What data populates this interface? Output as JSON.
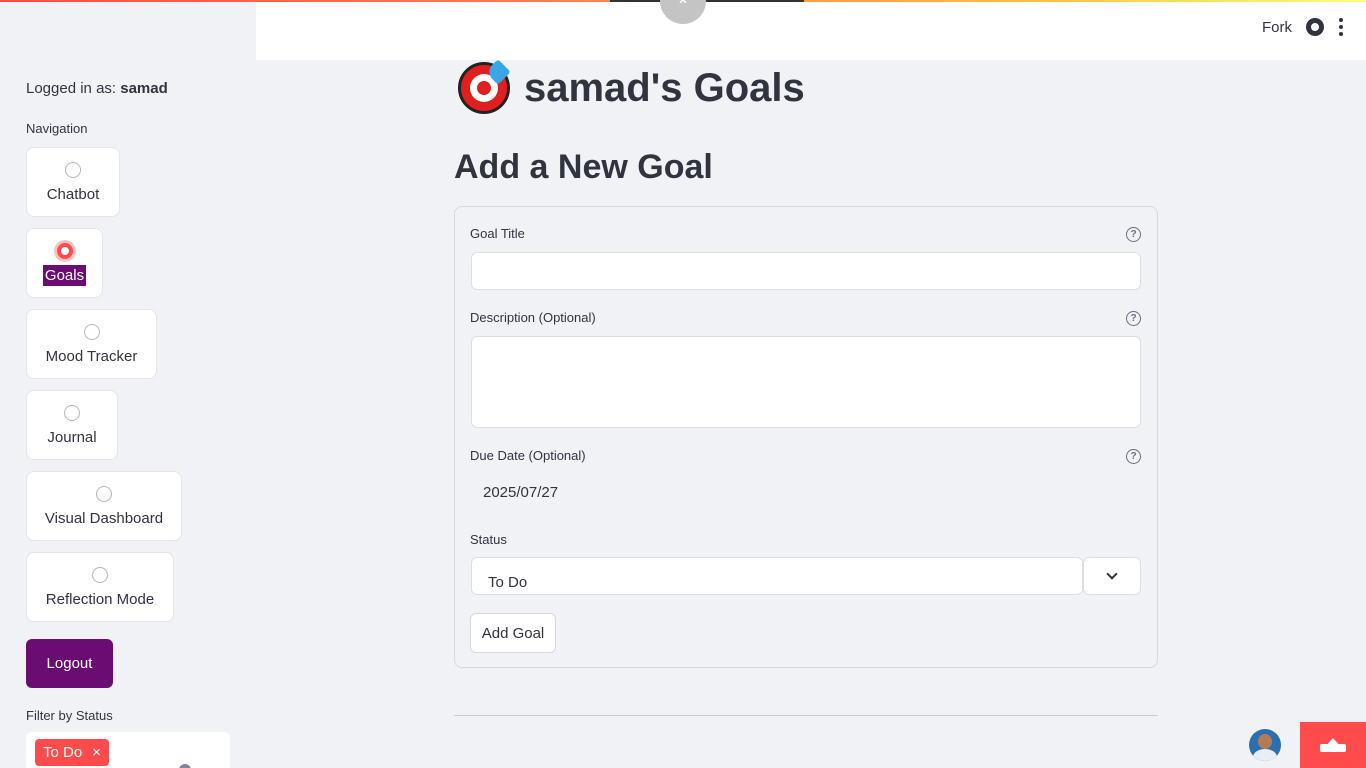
{
  "header": {
    "fork_label": "Fork",
    "github_icon": "github-icon",
    "menu_icon": "vertical-dots-icon",
    "collapse_icon": "chevron-up-icon"
  },
  "sidebar": {
    "logged_in_prefix": "Logged in as: ",
    "username": "samad",
    "navigation_label": "Navigation",
    "nav_items": [
      {
        "label": "Chatbot",
        "selected": false
      },
      {
        "label": "Goals",
        "selected": true
      },
      {
        "label": "Mood Tracker",
        "selected": false
      },
      {
        "label": "Journal",
        "selected": false
      },
      {
        "label": "Visual Dashboard",
        "selected": false
      },
      {
        "label": "Reflection Mode",
        "selected": false
      }
    ],
    "logout_label": "Logout",
    "filter_label": "Filter by Status",
    "filter_tag": "To Do",
    "filter_tag_remove": "×"
  },
  "main": {
    "page_title": "samad's Goals",
    "page_icon": "direct-hit-target-icon",
    "section_title": "Add a New Goal",
    "form": {
      "goal_title_label": "Goal Title",
      "goal_title_value": "",
      "description_label": "Description (Optional)",
      "description_value": "",
      "due_date_label": "Due Date (Optional)",
      "due_date_value": "2025/07/27",
      "status_label": "Status",
      "status_value": "To Do",
      "help_glyph": "?",
      "submit_label": "Add Goal"
    }
  },
  "colors": {
    "accent": "#ff4b4b",
    "brand_purple": "#6b0c73",
    "background": "#f0f2f6"
  }
}
